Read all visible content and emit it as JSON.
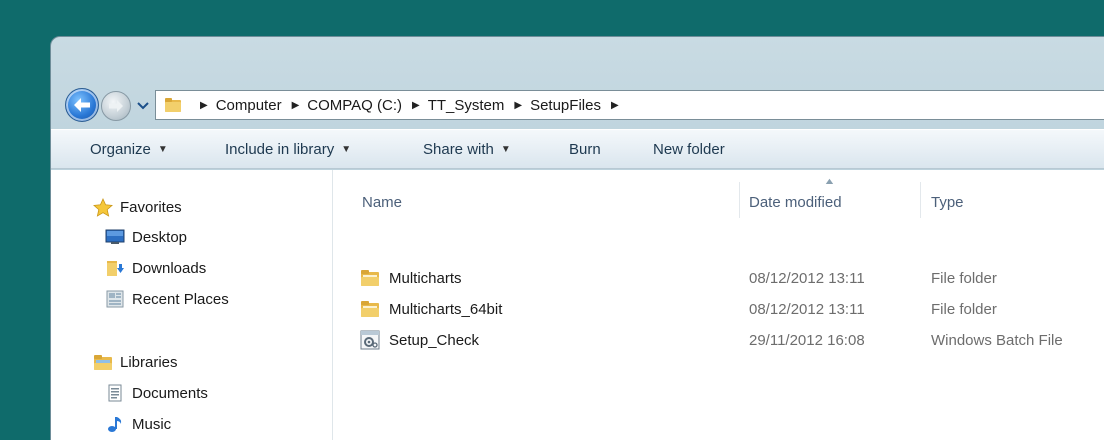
{
  "breadcrumb": [
    {
      "label": "Computer"
    },
    {
      "label": "COMPAQ (C:)"
    },
    {
      "label": "TT_System"
    },
    {
      "label": "SetupFiles"
    }
  ],
  "toolbar": {
    "organize": "Organize",
    "include_in_library": "Include in library",
    "share_with": "Share with",
    "burn": "Burn",
    "new_folder": "New folder"
  },
  "sidebar": {
    "favorites": {
      "label": "Favorites",
      "items": [
        {
          "label": "Desktop",
          "icon": "desktop-icon"
        },
        {
          "label": "Downloads",
          "icon": "downloads-folder-icon"
        },
        {
          "label": "Recent Places",
          "icon": "recent-places-icon"
        }
      ]
    },
    "libraries": {
      "label": "Libraries",
      "items": [
        {
          "label": "Documents",
          "icon": "documents-icon"
        },
        {
          "label": "Music",
          "icon": "music-icon"
        }
      ]
    }
  },
  "columns": {
    "name": "Name",
    "date_modified": "Date modified",
    "type": "Type"
  },
  "files": [
    {
      "name": "Multicharts",
      "date": "08/12/2012 13:11",
      "type": "File folder",
      "icon": "folder-icon"
    },
    {
      "name": "Multicharts_64bit",
      "date": "08/12/2012 13:11",
      "type": "File folder",
      "icon": "folder-icon"
    },
    {
      "name": "Setup_Check",
      "date": "29/11/2012 16:08",
      "type": "Windows Batch File",
      "icon": "batch-file-icon"
    }
  ],
  "colors": {
    "desktop_background": "#0f6b6b",
    "accent_blue": "#2a78d6",
    "folder_yellow": "#e8b94a"
  }
}
